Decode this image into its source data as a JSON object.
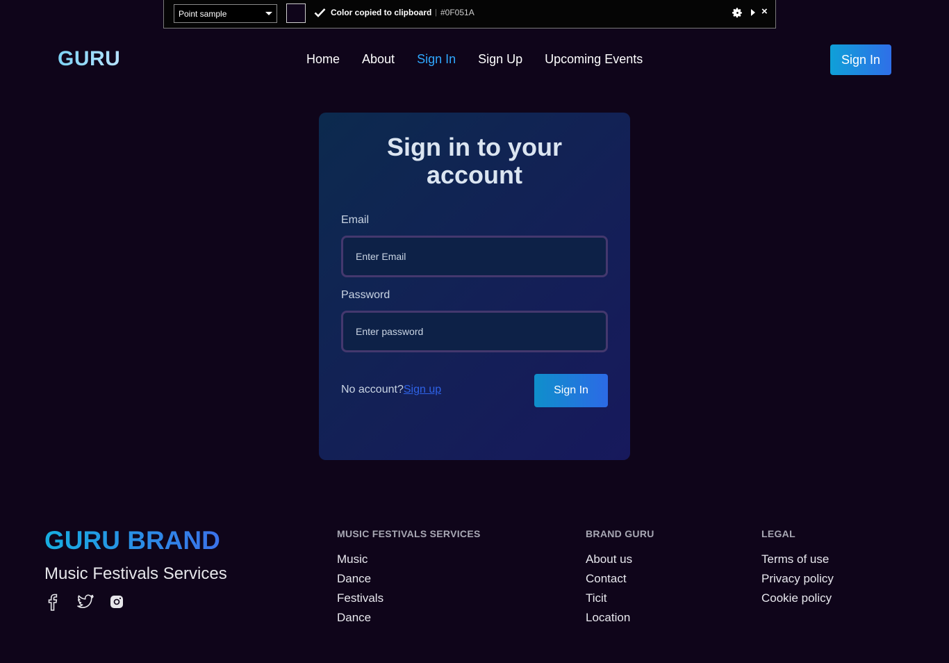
{
  "picker": {
    "mode": "Point sample",
    "message": "Color copied to clipboard",
    "separator": "|",
    "hex": "#0F051A",
    "swatch_color": "#0F051A",
    "close": "×"
  },
  "nav": {
    "logo": "GURU",
    "links": [
      "Home",
      "About",
      "Sign In",
      "Sign Up",
      "Upcoming Events"
    ],
    "active": "Sign In",
    "button": "Sign In"
  },
  "form": {
    "title": "Sign in to your account",
    "email_label": "Email",
    "email_placeholder": "Enter Email",
    "password_label": "Password",
    "password_placeholder": "Enter password",
    "no_account": "No account?",
    "signup_link": "Sign up",
    "submit": "Sign In"
  },
  "footer": {
    "brand": "GURU BRAND",
    "tagline": "Music Festivals Services",
    "socials": [
      "facebook-icon",
      "twitter-icon",
      "instagram-icon"
    ],
    "columns": [
      {
        "heading": "MUSIC FESTIVALS SERVICES",
        "items": [
          "Music",
          "Dance",
          "Festivals",
          "Dance"
        ]
      },
      {
        "heading": "BRAND GURU",
        "items": [
          "About us",
          "Contact",
          "Ticit",
          "Location"
        ]
      },
      {
        "heading": "LEGAL",
        "items": [
          "Terms of use",
          "Privacy policy",
          "Cookie policy"
        ]
      }
    ]
  },
  "colors": {
    "background": "#0F051A",
    "accent": "#2FA8FF",
    "button_start": "#0FA0D8",
    "button_end": "#2F6FE8"
  }
}
